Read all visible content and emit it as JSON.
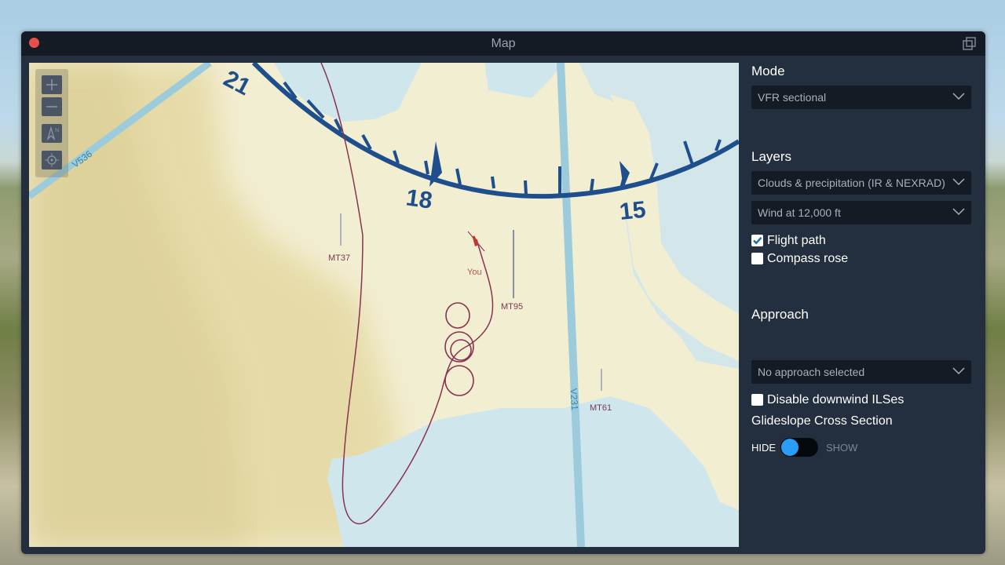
{
  "window": {
    "title": "Map"
  },
  "map": {
    "airway_labels": [
      "V536",
      "V231"
    ],
    "compass_numbers": [
      "21",
      "18",
      "15"
    ],
    "airports": [
      "MT37",
      "MT95",
      "MT61"
    ],
    "aircraft_label": "You",
    "zoom_controls": [
      "zoom-in",
      "zoom-out",
      "north-up",
      "center-on-aircraft"
    ]
  },
  "panel": {
    "mode": {
      "title": "Mode",
      "selected": "VFR sectional"
    },
    "layers": {
      "title": "Layers",
      "weather_selected": "Clouds & precipitation (IR & NEXRAD)",
      "wind_selected": "Wind at 12,000 ft",
      "flight_path": {
        "label": "Flight path",
        "checked": true
      },
      "compass_rose": {
        "label": "Compass rose",
        "checked": false
      }
    },
    "approach": {
      "title": "Approach",
      "selected": "No approach selected",
      "disable_downwind": {
        "label": "Disable downwind ILSes",
        "checked": false
      },
      "glideslope_title": "Glideslope Cross Section",
      "toggle_hide": "HIDE",
      "toggle_show": "SHOW"
    }
  },
  "colors": {
    "window_bg": "#232f3e",
    "titlebar_bg": "#141b24",
    "land": "#f2eed2",
    "water": "#cfe6ec",
    "airway": "#9ccbdb",
    "compass": "#1f4e8c",
    "flight_path": "#8a3350",
    "toggle_accent": "#2a9df4"
  }
}
